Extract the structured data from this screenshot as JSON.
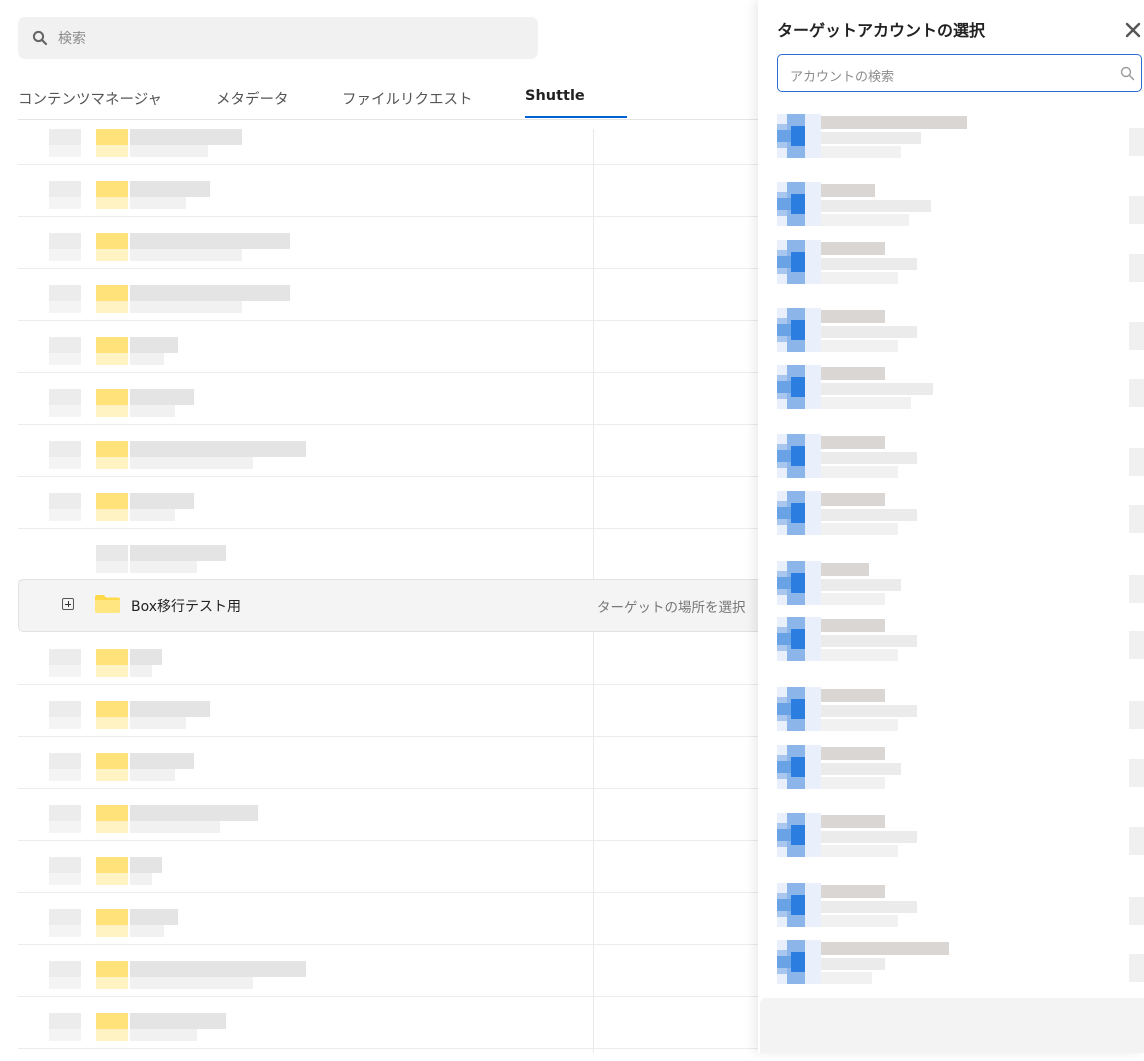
{
  "search": {
    "placeholder": "検索"
  },
  "tabs": [
    {
      "label": "コンテンツマネージャ",
      "active": false
    },
    {
      "label": "メタデータ",
      "active": false
    },
    {
      "label": "ファイルリクエスト",
      "active": false
    },
    {
      "label": "Shuttle",
      "active": true
    }
  ],
  "highlighted_row": {
    "name": "Box移行テスト用",
    "target_placeholder": "ターゲットの場所を選択"
  },
  "panel": {
    "title": "ターゲットアカウントの選択",
    "search_placeholder": "アカウントの検索"
  },
  "colors": {
    "accent": "#0061d5",
    "folder": "#ffdf5c",
    "avatar": "#2b7de0"
  },
  "icons": [
    "search-icon",
    "expand-icon",
    "folder-icon",
    "close-icon"
  ]
}
